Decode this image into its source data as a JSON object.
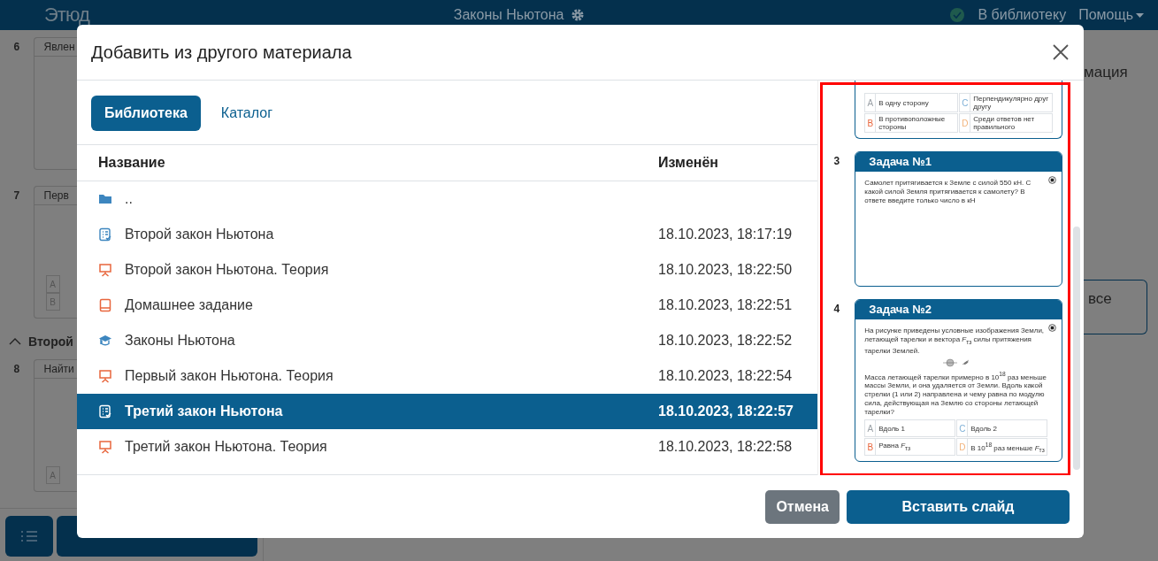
{
  "header": {
    "logo": "Этюд",
    "title": "Законы Ньютона",
    "library_link": "В библиотеку",
    "help_menu": "Помощь"
  },
  "background": {
    "slides": [
      {
        "number": "6",
        "title": "Явлен"
      },
      {
        "number": "7",
        "title": "Перв",
        "options": [
          "A",
          "B"
        ]
      },
      {
        "number": "8",
        "title": "Найти",
        "options": [
          "A"
        ],
        "section": "Второй"
      }
    ],
    "right_heading": "мация",
    "right_button": "все"
  },
  "dialog": {
    "title": "Добавить из другого материала",
    "tabs": [
      {
        "label": "Библиотека",
        "selected": true
      },
      {
        "label": "Каталог",
        "selected": false
      }
    ],
    "columns": [
      "Название",
      "Изменён"
    ],
    "rows": [
      {
        "kind": "folder",
        "name": "..",
        "modified": "",
        "selected": false
      },
      {
        "kind": "test",
        "name": "Второй закон Ньютона",
        "modified": "18.10.2023, 18:17:19",
        "selected": false
      },
      {
        "kind": "presentation",
        "name": "Второй закон Ньютона. Теория",
        "modified": "18.10.2023, 18:22:50",
        "selected": false
      },
      {
        "kind": "book",
        "name": "Домашнее задание",
        "modified": "18.10.2023, 18:22:51",
        "selected": false
      },
      {
        "kind": "course",
        "name": "Законы Ньютона",
        "modified": "18.10.2023, 18:22:52",
        "selected": false
      },
      {
        "kind": "presentation",
        "name": "Первый закон Ньютона. Теория",
        "modified": "18.10.2023, 18:22:54",
        "selected": false
      },
      {
        "kind": "test",
        "name": "Третий закон Ньютона",
        "modified": "18.10.2023, 18:22:57",
        "selected": true
      },
      {
        "kind": "presentation",
        "name": "Третий закон Ньютона. Теория",
        "modified": "18.10.2023, 18:22:58",
        "selected": false
      }
    ],
    "preview": {
      "partial_options": [
        {
          "letter": "A",
          "text": "В одну сторону",
          "color": "#9aa0a6"
        },
        {
          "letter": "C",
          "text": "Перпендикулярно друг другу",
          "color": "#7fb0d6"
        },
        {
          "letter": "B",
          "text": "В противоположные стороны",
          "color": "#e8663d"
        },
        {
          "letter": "D",
          "text": "Среди ответов нет правильного",
          "color": "#f2b27a"
        }
      ],
      "slides": [
        {
          "number": "3",
          "title": "Задача №1",
          "paragraphs": [
            "Самолет притягивается к Земле с силой 550 кН. С какой силой Земля притягивается к самолету? В ответе введите только число в кН"
          ],
          "figure": false
        },
        {
          "number": "4",
          "title": "Задача №2",
          "paragraphs": [
            "На рисунке приведены условные изображения Земли, летающей тарелки и вектора *F*$_{тз}$ силы притяжения тарелки Землей.",
            "Масса летающей тарелки примерно в 10$^{18}$ раз меньше массы Земли, и она удаляется от Земли. Вдоль какой стрелки (1 или 2) направлена и чему равна по модулю сила, действующая на Землю со стороны летающей тарелки?"
          ],
          "figure": true,
          "options": [
            {
              "letter": "A",
              "text": "Вдоль 1",
              "color": "#9aa0a6"
            },
            {
              "letter": "C",
              "text": "Вдоль 2",
              "color": "#7fb0d6"
            },
            {
              "letter": "B",
              "text": "Равна *F*$_{тз}$",
              "color": "#e8663d"
            },
            {
              "letter": "D",
              "text": "В 10$^{18}$ раз меньше *F*$_{тз}$",
              "color": "#f2b27a"
            }
          ]
        }
      ]
    },
    "buttons": [
      {
        "label": "Отмена",
        "kind": "secondary"
      },
      {
        "label": "Вставить слайд",
        "kind": "primary"
      }
    ]
  }
}
